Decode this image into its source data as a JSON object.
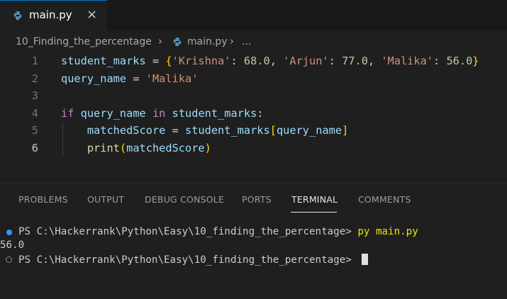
{
  "tab": {
    "label": "main.py",
    "close": "×",
    "icon": "python-file-icon"
  },
  "breadcrumb": {
    "folder": "10_Finding_the_percentage",
    "sep": "›",
    "file": "main.py",
    "more": "..."
  },
  "editor": {
    "lines": [
      {
        "n": "1",
        "tokens": [
          {
            "t": "student_marks",
            "c": "k-var"
          },
          {
            "t": " = ",
            "c": "k-op"
          },
          {
            "t": "{",
            "c": "k-br1"
          },
          {
            "t": "'Krishna'",
            "c": "k-str"
          },
          {
            "t": ": ",
            "c": "k-op"
          },
          {
            "t": "68.0",
            "c": "k-num"
          },
          {
            "t": ", ",
            "c": "k-op"
          },
          {
            "t": "'Arjun'",
            "c": "k-str"
          },
          {
            "t": ": ",
            "c": "k-op"
          },
          {
            "t": "77.0",
            "c": "k-num"
          },
          {
            "t": ", ",
            "c": "k-op"
          },
          {
            "t": "'Malika'",
            "c": "k-str"
          },
          {
            "t": ": ",
            "c": "k-op"
          },
          {
            "t": "56.0",
            "c": "k-num"
          },
          {
            "t": "}",
            "c": "k-br1"
          }
        ]
      },
      {
        "n": "2",
        "tokens": [
          {
            "t": "query_name",
            "c": "k-var"
          },
          {
            "t": " = ",
            "c": "k-op"
          },
          {
            "t": "'Malika'",
            "c": "k-str"
          }
        ]
      },
      {
        "n": "3",
        "tokens": []
      },
      {
        "n": "4",
        "tokens": [
          {
            "t": "if",
            "c": "k-kw"
          },
          {
            "t": " ",
            "c": "k-op"
          },
          {
            "t": "query_name",
            "c": "k-var"
          },
          {
            "t": " ",
            "c": "k-op"
          },
          {
            "t": "in",
            "c": "k-kw"
          },
          {
            "t": " ",
            "c": "k-op"
          },
          {
            "t": "student_marks",
            "c": "k-var"
          },
          {
            "t": ":",
            "c": "k-op"
          }
        ]
      },
      {
        "n": "5",
        "tokens": [
          {
            "t": "    ",
            "c": "k-op"
          },
          {
            "t": "matchedScore",
            "c": "k-var"
          },
          {
            "t": " = ",
            "c": "k-op"
          },
          {
            "t": "student_marks",
            "c": "k-var"
          },
          {
            "t": "[",
            "c": "k-br1"
          },
          {
            "t": "query_name",
            "c": "k-var"
          },
          {
            "t": "]",
            "c": "k-br1"
          }
        ]
      },
      {
        "n": "6",
        "tokens": [
          {
            "t": "    ",
            "c": "k-op"
          },
          {
            "t": "print",
            "c": "k-fn"
          },
          {
            "t": "(",
            "c": "k-br1"
          },
          {
            "t": "matchedScore",
            "c": "k-var"
          },
          {
            "t": ")",
            "c": "k-br1"
          }
        ]
      }
    ],
    "active_line": "6"
  },
  "panel": {
    "tabs": [
      "PROBLEMS",
      "OUTPUT",
      "DEBUG CONSOLE",
      "PORTS",
      "TERMINAL",
      "COMMENTS"
    ],
    "active": "TERMINAL"
  },
  "terminal": {
    "prompt1": "PS C:\\Hackerrank\\Python\\Easy\\10_finding_the_percentage> ",
    "command1": "py main.py",
    "output": "56.0",
    "prompt2": "PS C:\\Hackerrank\\Python\\Easy\\10_finding_the_percentage> "
  },
  "colors": {
    "accent": "#0078d4",
    "editor_bg": "#1f1f1f",
    "tabbar_bg": "#181818"
  }
}
